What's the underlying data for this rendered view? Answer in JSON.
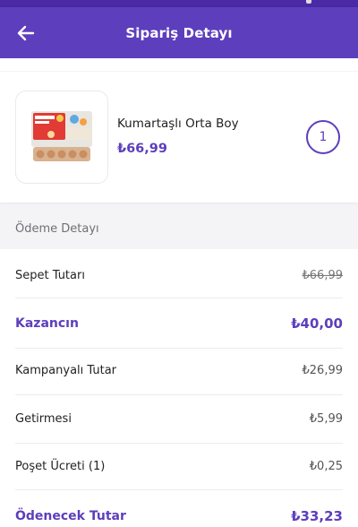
{
  "header": {
    "title": "Sipariş Detayı"
  },
  "product": {
    "name": "Kumartaşlı Orta Boy",
    "price": "₺66,99",
    "quantity": "1"
  },
  "payment": {
    "section_title": "Ödeme Detayı",
    "rows": [
      {
        "label": "Sepet Tutarı",
        "value": "₺66,99"
      },
      {
        "label": "Kazancın",
        "value": "₺40,00"
      },
      {
        "label": "Kampanyalı Tutar",
        "value": "₺26,99"
      },
      {
        "label": "Getirmesi",
        "value": "₺5,99"
      },
      {
        "label": "Poşet Ücreti (1)",
        "value": "₺0,25"
      },
      {
        "label": "Ödenecek Tutar",
        "value": "₺33,23"
      }
    ]
  },
  "colors": {
    "brand": "#5d3ebc",
    "brand_dark": "#4b2aa6"
  },
  "icons": {
    "back": "arrow-left-icon",
    "product_image": "egg-carton-image"
  }
}
